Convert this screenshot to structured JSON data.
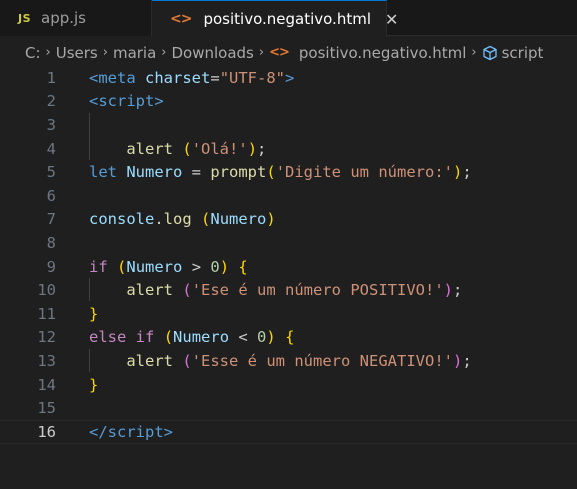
{
  "tabs": [
    {
      "badge": "JS",
      "label": "app.js",
      "active": false
    },
    {
      "icon": "<>",
      "label": "positivo.negativo.html",
      "active": true,
      "close": "✕"
    }
  ],
  "breadcrumb": {
    "items": [
      "C:",
      "Users",
      "maria",
      "Downloads",
      "positivo.negativo.html",
      "script"
    ],
    "separator": "›"
  },
  "editor": {
    "current_line": 16,
    "lines": [
      {
        "n": "1",
        "tokens": [
          [
            "t-tag",
            "<"
          ],
          [
            "t-tag",
            "meta"
          ],
          [
            "t-txt",
            " "
          ],
          [
            "t-attr",
            "charset"
          ],
          [
            "t-txt",
            "="
          ],
          [
            "t-str",
            "\"UTF-8\""
          ],
          [
            "t-tag",
            ">"
          ]
        ]
      },
      {
        "n": "2",
        "tokens": [
          [
            "t-tag",
            "<"
          ],
          [
            "t-tag",
            "script"
          ],
          [
            "t-tag",
            ">"
          ]
        ]
      },
      {
        "n": "3",
        "tokens": []
      },
      {
        "n": "4",
        "tokens": [
          [
            "t-txt",
            "    "
          ],
          [
            "t-fn",
            "alert"
          ],
          [
            "t-txt",
            " "
          ],
          [
            "t-b1",
            "("
          ],
          [
            "t-str",
            "'Olá!'"
          ],
          [
            "t-b1",
            ")"
          ],
          [
            "t-txt",
            ";"
          ]
        ]
      },
      {
        "n": "5",
        "tokens": [
          [
            "t-kw",
            "let"
          ],
          [
            "t-txt",
            " "
          ],
          [
            "t-var",
            "Numero"
          ],
          [
            "t-txt",
            " = "
          ],
          [
            "t-fn",
            "prompt"
          ],
          [
            "t-b1",
            "("
          ],
          [
            "t-str",
            "'Digite um número:'"
          ],
          [
            "t-b1",
            ")"
          ],
          [
            "t-txt",
            ";"
          ]
        ]
      },
      {
        "n": "6",
        "tokens": []
      },
      {
        "n": "7",
        "tokens": [
          [
            "t-var",
            "console"
          ],
          [
            "t-txt",
            "."
          ],
          [
            "t-fn",
            "log"
          ],
          [
            "t-txt",
            " "
          ],
          [
            "t-b1",
            "("
          ],
          [
            "t-var",
            "Numero"
          ],
          [
            "t-b1",
            ")"
          ]
        ]
      },
      {
        "n": "8",
        "tokens": []
      },
      {
        "n": "9",
        "tokens": [
          [
            "t-ctrl",
            "if"
          ],
          [
            "t-txt",
            " "
          ],
          [
            "t-b1",
            "("
          ],
          [
            "t-var",
            "Numero"
          ],
          [
            "t-txt",
            " > "
          ],
          [
            "t-num",
            "0"
          ],
          [
            "t-b1",
            ")"
          ],
          [
            "t-txt",
            " "
          ],
          [
            "t-b1",
            "{"
          ]
        ]
      },
      {
        "n": "10",
        "tokens": [
          [
            "t-txt",
            "    "
          ],
          [
            "t-fn",
            "alert"
          ],
          [
            "t-txt",
            " "
          ],
          [
            "t-b2",
            "("
          ],
          [
            "t-str",
            "'Ese é um número POSITIVO!'"
          ],
          [
            "t-b2",
            ")"
          ],
          [
            "t-txt",
            ";"
          ]
        ]
      },
      {
        "n": "11",
        "tokens": [
          [
            "t-b1",
            "}"
          ]
        ]
      },
      {
        "n": "12",
        "tokens": [
          [
            "t-ctrl",
            "else"
          ],
          [
            "t-txt",
            " "
          ],
          [
            "t-ctrl",
            "if"
          ],
          [
            "t-txt",
            " "
          ],
          [
            "t-b1",
            "("
          ],
          [
            "t-var",
            "Numero"
          ],
          [
            "t-txt",
            " < "
          ],
          [
            "t-num",
            "0"
          ],
          [
            "t-b1",
            ")"
          ],
          [
            "t-txt",
            " "
          ],
          [
            "t-b1",
            "{"
          ]
        ]
      },
      {
        "n": "13",
        "tokens": [
          [
            "t-txt",
            "    "
          ],
          [
            "t-fn",
            "alert"
          ],
          [
            "t-txt",
            " "
          ],
          [
            "t-b2",
            "("
          ],
          [
            "t-str",
            "'Esse é um número NEGATIVO!'"
          ],
          [
            "t-b2",
            ")"
          ],
          [
            "t-txt",
            ";"
          ]
        ]
      },
      {
        "n": "14",
        "tokens": [
          [
            "t-b1",
            "}"
          ]
        ]
      },
      {
        "n": "15",
        "tokens": []
      },
      {
        "n": "16",
        "tokens": [
          [
            "t-tag",
            "</"
          ],
          [
            "t-tag",
            "script"
          ],
          [
            "t-tag",
            ">"
          ]
        ]
      }
    ]
  }
}
